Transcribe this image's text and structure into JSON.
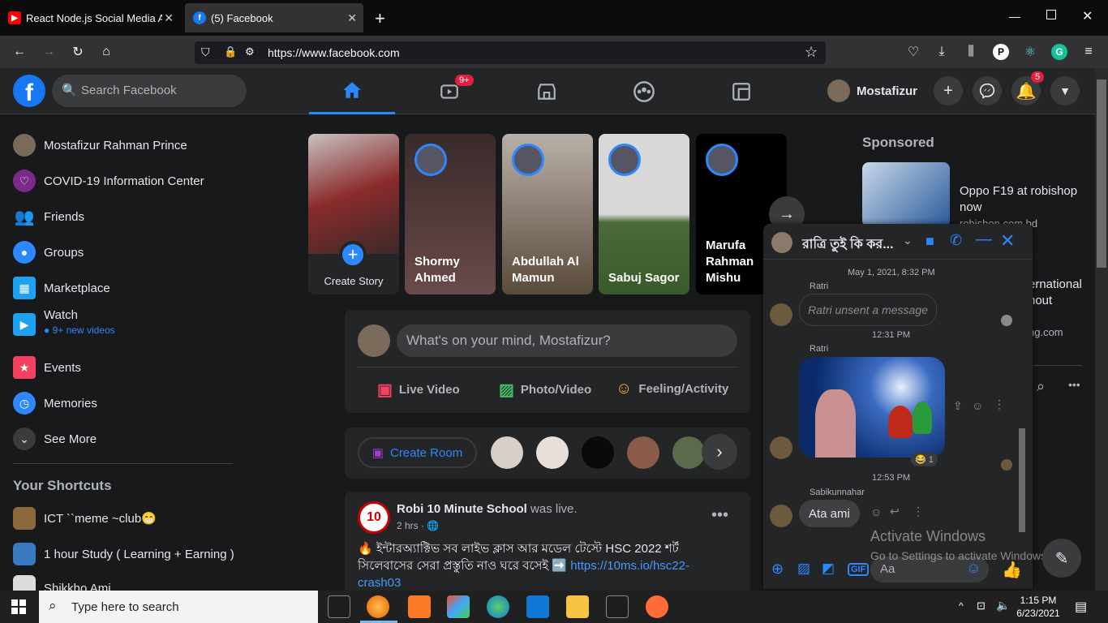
{
  "browser": {
    "tabs": [
      {
        "title": "React Node.js Social Media App",
        "active": false
      },
      {
        "title": "(5) Facebook",
        "active": true
      }
    ],
    "new_tab_label": "+",
    "url": "https://www.facebook.com"
  },
  "header": {
    "search_placeholder": "Search Facebook",
    "watch_badge": "9+",
    "profile_name": "Mostafizur",
    "notifications_badge": "5"
  },
  "sidebar": {
    "items": [
      {
        "label": "Mostafizur Rahman Prince",
        "icon": "avatar"
      },
      {
        "label": "COVID-19 Information Center",
        "icon": "heart-icon"
      },
      {
        "label": "Friends",
        "icon": "friends-icon"
      },
      {
        "label": "Groups",
        "icon": "groups-icon"
      },
      {
        "label": "Marketplace",
        "icon": "marketplace-icon"
      },
      {
        "label": "Watch",
        "icon": "watch-icon",
        "sub": "9+ new videos"
      },
      {
        "label": "Events",
        "icon": "calendar-icon"
      },
      {
        "label": "Memories",
        "icon": "clock-icon"
      },
      {
        "label": "See More",
        "icon": "chevron-down-icon"
      }
    ],
    "shortcuts_title": "Your Shortcuts",
    "shortcuts": [
      {
        "label": "ICT ``meme ~club😁"
      },
      {
        "label": "1 hour Study ( Learning + Earning )"
      },
      {
        "label": "Shikkho Ami"
      }
    ]
  },
  "stories": [
    {
      "name": "Create Story"
    },
    {
      "name": "Shormy Ahmed"
    },
    {
      "name": "Abdullah Al Mamun"
    },
    {
      "name": "Sabuj Sagor"
    },
    {
      "name": "Marufa Rahman Mishu"
    }
  ],
  "composer": {
    "placeholder": "What's on your mind, Mostafizur?",
    "actions": [
      "Live Video",
      "Photo/Video",
      "Feeling/Activity"
    ]
  },
  "rooms": {
    "create_label": "Create Room"
  },
  "post": {
    "author": "Robi 10 Minute School",
    "action": "was live.",
    "time": "2 hrs · 🌐",
    "text": "🔥 ইন্টারঅ্যাক্টিভ সব লাইভ ক্লাস আর মডেল টেস্টে HSC 2022 শর্ট সিলেবাসের সেরা প্রস্তুতি নাও ঘরে বসেই ➡️",
    "link": "https://10ms.io/hsc22-crash03"
  },
  "sponsored": {
    "title": "Sponsored",
    "ad1_title": "Oppo F19 at robishop now",
    "ad1_site": "robishop.com.bd",
    "ad2_title": "ernational",
    "ad2_sub": "hout",
    "ad2_site": "ng.com"
  },
  "chat": {
    "title": "রাত্রি তুই কি কর...",
    "messages": [
      {
        "meta": "May 1, 2021, 8:32 PM"
      },
      {
        "sender": "Ratri",
        "text": "Ratri unsent a message"
      },
      {
        "meta": "12:31 PM"
      },
      {
        "sender": "Ratri",
        "reaction": "😂 1"
      },
      {
        "meta": "12:53 PM"
      },
      {
        "sender": "Sabikunnahar",
        "text": "Ata ami"
      }
    ],
    "input_placeholder": "Aa"
  },
  "watermark": {
    "line1": "Activate Windows",
    "line2": "Go to Settings to activate Windows."
  },
  "taskbar": {
    "search_placeholder": "Type here to search",
    "time": "1:15 PM",
    "date": "6/23/2021"
  }
}
